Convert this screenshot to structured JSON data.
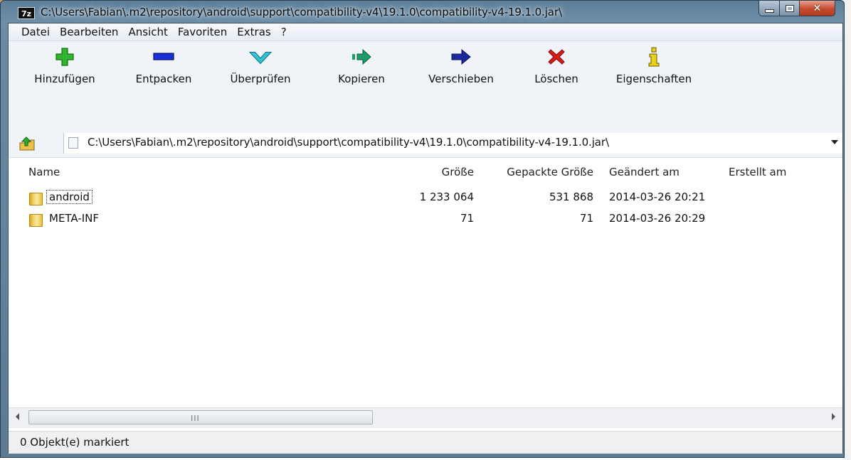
{
  "window": {
    "title": "C:\\Users\\Fabian\\.m2\\repository\\android\\support\\compatibility-v4\\19.1.0\\compatibility-v4-19.1.0.jar\\",
    "app_icon_text": "7z"
  },
  "menu": [
    "Datei",
    "Bearbeiten",
    "Ansicht",
    "Favoriten",
    "Extras",
    "?"
  ],
  "toolbar": {
    "add": "Hinzufügen",
    "extract": "Entpacken",
    "test": "Überprüfen",
    "copy": "Kopieren",
    "move": "Verschieben",
    "delete": "Löschen",
    "properties": "Eigenschaften"
  },
  "address": {
    "path": "C:\\Users\\Fabian\\.m2\\repository\\android\\support\\compatibility-v4\\19.1.0\\compatibility-v4-19.1.0.jar\\"
  },
  "columns": {
    "name": "Name",
    "size": "Größe",
    "packed": "Gepackte Größe",
    "modified": "Geändert am",
    "created": "Erstellt am"
  },
  "files": [
    {
      "name": "android",
      "size": "1 233 064",
      "packed": "531 868",
      "modified": "2014-03-26 20:21",
      "created": ""
    },
    {
      "name": "META-INF",
      "size": "71",
      "packed": "71",
      "modified": "2014-03-26 20:29",
      "created": ""
    }
  ],
  "scrollbar": {
    "grip": "III"
  },
  "status": "0 Objekt(e) markiert",
  "colors": {
    "frame": "#6a8aa3",
    "add_icon": "#2fb52f",
    "extract_icon": "#1a2fd8",
    "test_icon": "#33c3d6",
    "copy_icon": "#1f9a6a",
    "move_icon": "#1a2aa0",
    "delete_icon": "#d81a1a",
    "properties_icon": "#e8d21a"
  }
}
